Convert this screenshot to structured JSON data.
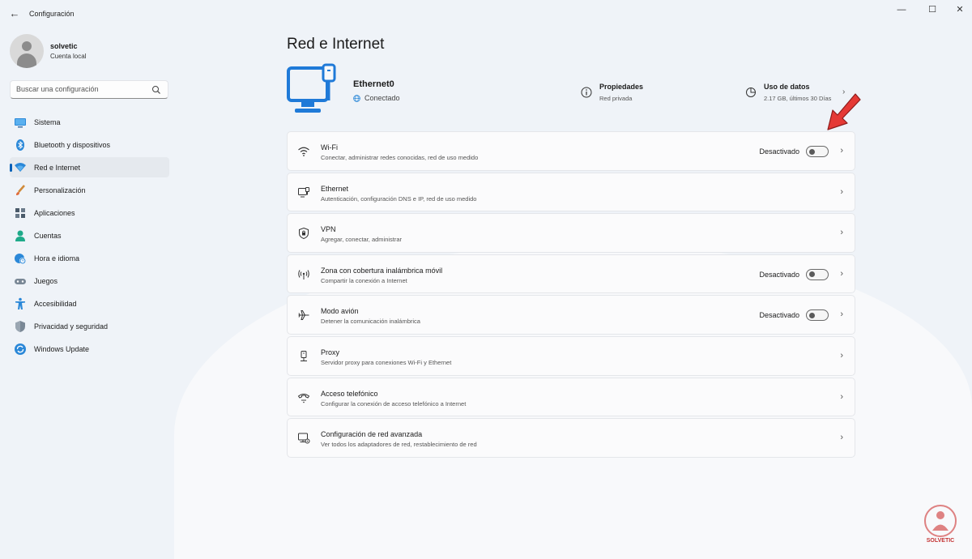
{
  "window": {
    "title": "Configuración",
    "back_glyph": "←",
    "minimize_glyph": "—",
    "maximize_glyph": "☐",
    "close_glyph": "✕"
  },
  "user": {
    "name": "solvetic",
    "account_type": "Cuenta local"
  },
  "search": {
    "placeholder": "Buscar una configuración"
  },
  "sidebar": {
    "items": [
      {
        "label": "Sistema",
        "icon": "system-icon"
      },
      {
        "label": "Bluetooth y dispositivos",
        "icon": "bluetooth-icon"
      },
      {
        "label": "Red e Internet",
        "icon": "network-icon",
        "active": true
      },
      {
        "label": "Personalización",
        "icon": "brush-icon"
      },
      {
        "label": "Aplicaciones",
        "icon": "apps-icon"
      },
      {
        "label": "Cuentas",
        "icon": "account-icon"
      },
      {
        "label": "Hora e idioma",
        "icon": "globe-clock-icon"
      },
      {
        "label": "Juegos",
        "icon": "gamepad-icon"
      },
      {
        "label": "Accesibilidad",
        "icon": "accessibility-icon"
      },
      {
        "label": "Privacidad y seguridad",
        "icon": "shield-icon"
      },
      {
        "label": "Windows Update",
        "icon": "update-icon"
      }
    ]
  },
  "main": {
    "title": "Red e Internet",
    "connection": {
      "name": "Ethernet0",
      "status": "Conectado"
    },
    "properties": {
      "title": "Propiedades",
      "subtitle": "Red privada"
    },
    "data_usage": {
      "title": "Uso de datos",
      "subtitle": "2.17 GB, últimos 30 Días"
    },
    "cards": [
      {
        "title": "Wi-Fi",
        "subtitle": "Conectar, administrar redes conocidas, red de uso medido",
        "state": "Desactivado",
        "toggle": false,
        "icon": "wifi-icon"
      },
      {
        "title": "Ethernet",
        "subtitle": "Autenticación, configuración DNS e IP, red de uso medido",
        "icon": "ethernet-icon"
      },
      {
        "title": "VPN",
        "subtitle": "Agregar, conectar, administrar",
        "icon": "vpn-shield-icon"
      },
      {
        "title": "Zona con cobertura inalámbrica móvil",
        "subtitle": "Compartir la conexión a Internet",
        "state": "Desactivado",
        "toggle": false,
        "icon": "hotspot-icon"
      },
      {
        "title": "Modo avión",
        "subtitle": "Detener la comunicación inalámbrica",
        "state": "Desactivado",
        "toggle": false,
        "icon": "airplane-icon"
      },
      {
        "title": "Proxy",
        "subtitle": "Servidor proxy para conexiones Wi-Fi y Ethernet",
        "icon": "proxy-icon"
      },
      {
        "title": "Acceso telefónico",
        "subtitle": "Configurar la conexión de acceso telefónico a Internet",
        "icon": "dialup-icon"
      },
      {
        "title": "Configuración de red avanzada",
        "subtitle": "Ver todos los adaptadores de red, restablecimiento de red",
        "icon": "advanced-network-icon"
      }
    ]
  },
  "watermark": {
    "text": "SOLVETIC"
  },
  "colors": {
    "accent": "#005fb8",
    "arrow": "#e53935",
    "background": "#eff3f8"
  }
}
